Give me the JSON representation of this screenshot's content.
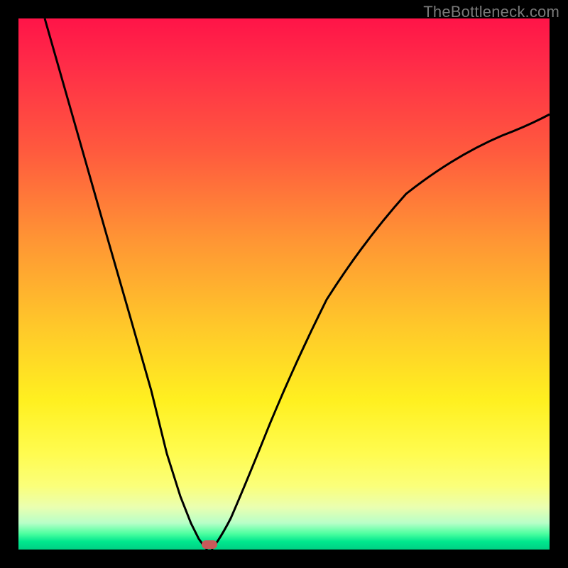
{
  "watermark": "TheBottleneck.com",
  "chart_data": {
    "type": "line",
    "title": "",
    "xlabel": "",
    "ylabel": "",
    "xlim": [
      0,
      100
    ],
    "ylim": [
      0,
      100
    ],
    "series": [
      {
        "name": "left-branch",
        "x": [
          5,
          9,
          13,
          17,
          21,
          25,
          28,
          30.5,
          32.5,
          34,
          35,
          35.6
        ],
        "y": [
          100,
          86,
          72,
          58,
          44,
          30,
          18,
          10,
          5,
          2,
          0.5,
          0
        ]
      },
      {
        "name": "right-branch",
        "x": [
          36.4,
          38,
          40,
          43,
          47,
          52,
          58,
          65,
          73,
          82,
          91,
          100
        ],
        "y": [
          0,
          2,
          6,
          13,
          23,
          35,
          47,
          58,
          67,
          74,
          79,
          82
        ]
      }
    ],
    "marker": {
      "x": 36,
      "y": 0,
      "color": "#c85a5a"
    },
    "background_gradient": {
      "top": "#ff1448",
      "mid1": "#ff9634",
      "mid2": "#fff020",
      "bottom": "#00d084"
    }
  }
}
